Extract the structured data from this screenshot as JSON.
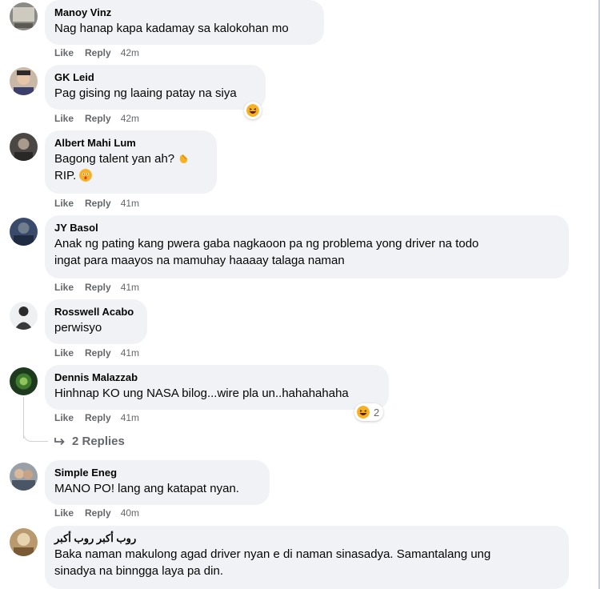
{
  "comments": [
    {
      "author": "Manoy Vinz",
      "lines": [
        "Nag hanap kapa kadamay sa kalokohan mo"
      ],
      "like": "Like",
      "reply": "Reply",
      "time": "42m"
    },
    {
      "author": "GK Leid",
      "lines": [
        "Pag gising ng laaing patay na siya"
      ],
      "like": "Like",
      "reply": "Reply",
      "time": "42m",
      "reaction": "laughing-reaction-icon"
    },
    {
      "author": "Albert Mahi Lum",
      "lines": [
        "Bagong talent yan ah?",
        "RIP."
      ],
      "like": "Like",
      "reply": "Reply",
      "time": "41m"
    },
    {
      "author": "JY Basol",
      "lines": [
        "Anak ng pating kang pwera gaba nagkaoon pa ng problema yong driver na todo",
        "ingat para maayos na mamuhay haaaay talaga naman"
      ],
      "like": "Like",
      "reply": "Reply",
      "time": "41m"
    },
    {
      "author": "Rosswell Acabo",
      "lines": [
        "perwisyo"
      ],
      "like": "Like",
      "reply": "Reply",
      "time": "41m"
    },
    {
      "author": "Dennis Malazzab",
      "lines": [
        "Hinhnap KO ung NASA bilog...wire pla un..hahahahaha"
      ],
      "like": "Like",
      "reply": "Reply",
      "time": "41m",
      "reaction": "laughing-reaction-icon",
      "reaction_count": "2"
    },
    {
      "author": "Simple Eneg",
      "lines": [
        "MANO PO! lang ang katapat nyan."
      ],
      "like": "Like",
      "reply": "Reply",
      "time": "40m"
    },
    {
      "author": "روب أكبر روب أكبر",
      "lines": [
        "Baka naman makulong agad driver nyan e di naman sinasadya. Samantalang ung",
        "sinadya na binngga laya pa din."
      ]
    }
  ],
  "replies_link": "2 Replies",
  "colors": {
    "bubble": "#f0f2f5",
    "meta": "#65676b",
    "text": "#050505",
    "reaction": "#f7b125"
  }
}
